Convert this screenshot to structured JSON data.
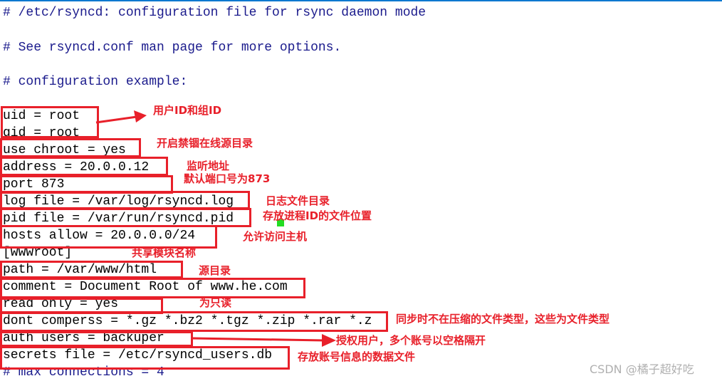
{
  "code_lines": [
    {
      "text": "# /etc/rsyncd: configuration file for rsync daemon mode",
      "type": "comment"
    },
    {
      "text": "# See rsyncd.conf man page for more options.",
      "type": "comment"
    },
    {
      "text": "# configuration example:",
      "type": "comment"
    },
    {
      "text": "uid = root",
      "type": "code"
    },
    {
      "text": "gid = root",
      "type": "code"
    },
    {
      "text": "use chroot = yes",
      "type": "code"
    },
    {
      "text": "address = 20.0.0.12",
      "type": "code"
    },
    {
      "text": "port 873",
      "type": "code"
    },
    {
      "text": "log file = /var/log/rsyncd.log",
      "type": "code"
    },
    {
      "text": "pid file = /var/run/rsyncd.pid",
      "type": "code"
    },
    {
      "text": "hosts allow = 20.0.0.0/24",
      "type": "code"
    },
    {
      "text": "[wwwroot]",
      "type": "code"
    },
    {
      "text": "path = /var/www/html",
      "type": "code"
    },
    {
      "text": "comment = Document Root of www.he.com",
      "type": "code"
    },
    {
      "text": "read only = yes",
      "type": "code"
    },
    {
      "text": "dont comperss = *.gz *.bz2 *.tgz *.zip *.rar *.z",
      "type": "code"
    },
    {
      "text": "auth users = backuper",
      "type": "code"
    },
    {
      "text": "secrets file = /etc/rsyncd_users.db",
      "type": "code"
    },
    {
      "text": "# max connections = 4",
      "type": "comment"
    }
  ],
  "annotations": {
    "uid_gid": "用户ID和组ID",
    "chroot": "开启禁锢在线源目录",
    "address": "监听地址",
    "port": "默认端口号为873",
    "log_file": "日志文件目录",
    "pid_file": "存放进程ID的文件位置",
    "hosts_allow": "允许访问主机",
    "module": "共享模块名称",
    "path": "源目录",
    "read_only": "为只读",
    "dont_compress": "同步时不在压缩的文件类型，这些为文件类型",
    "auth_users": "授权用户，多个账号以空格隔开",
    "secrets_file": "存放账号信息的数据文件"
  },
  "watermark": "CSDN @橘子超好吃",
  "colors": {
    "annotation": "#e8202a",
    "comment": "#1a1a8c",
    "accent_bar": "#0a78d0"
  }
}
